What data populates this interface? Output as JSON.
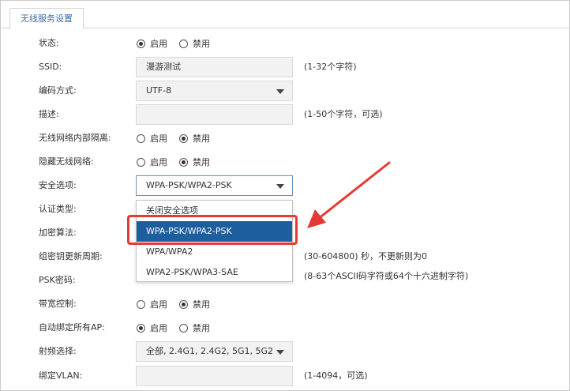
{
  "tab": {
    "label": "无线服务设置"
  },
  "option_on": "启用",
  "option_off": "禁用",
  "rows": {
    "status": {
      "label": "状态:"
    },
    "ssid": {
      "label": "SSID:",
      "value": "漫游测试",
      "hint": "(1-32个字符)"
    },
    "encoding": {
      "label": "编码方式:",
      "value": "UTF-8"
    },
    "description": {
      "label": "描述:",
      "value": "",
      "hint": "(1-50个字符，可选)"
    },
    "isolation": {
      "label": "无线网络内部隔离:"
    },
    "hide": {
      "label": "隐藏无线网络:"
    },
    "security": {
      "label": "安全选项:",
      "value": "WPA-PSK/WPA2-PSK"
    },
    "auth_type": {
      "label": "认证类型:"
    },
    "encryption": {
      "label": "加密算法:"
    },
    "group_key": {
      "label": "组密钥更新周期:",
      "hint": "(30-604800) 秒，不更新则为0"
    },
    "psk": {
      "label": "PSK密码:",
      "hint": "(8-63个ASCII码字符或64个十六进制字符)"
    },
    "bandwidth": {
      "label": "带宽控制:"
    },
    "auto_bind": {
      "label": "自动绑定所有AP:"
    },
    "rf": {
      "label": "射频选择:",
      "value": "全部, 2.4G1, 2.4G2, 5G1, 5G2"
    },
    "vlan": {
      "label": "绑定VLAN:",
      "value": "",
      "hint": "(1-4094，可选)"
    }
  },
  "dropdown": {
    "options": [
      "关闭安全选项",
      "WPA-PSK/WPA2-PSK",
      "WPA/WPA2",
      "WPA2-PSK/WPA3-SAE"
    ],
    "selected_index": 1
  },
  "colors": {
    "accent_blue": "#1d5e9e",
    "annotation_red": "#e53935",
    "tab_text": "#3a6ea5"
  }
}
